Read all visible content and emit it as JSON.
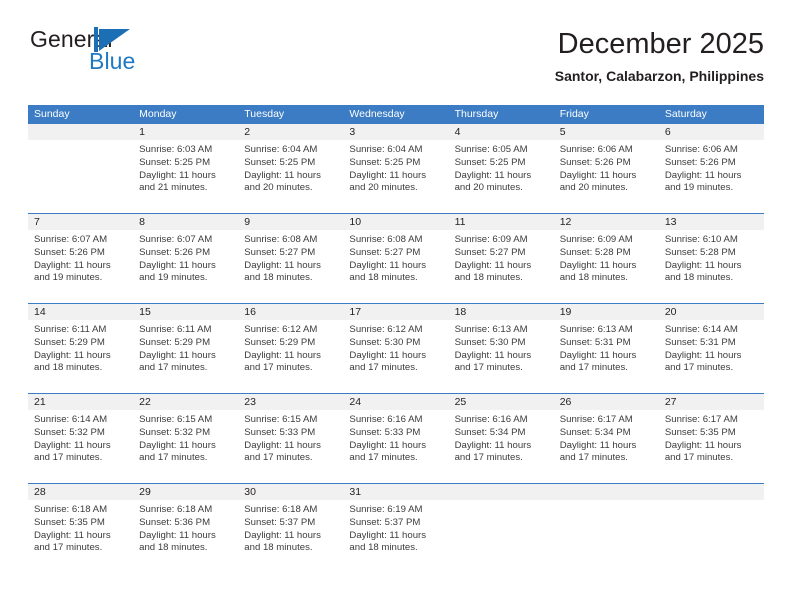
{
  "brand": {
    "name_primary": "General",
    "name_secondary": "Blue",
    "mark": "triangle-flag-icon",
    "accent_color": "#2079c2"
  },
  "header": {
    "month_title": "December 2025",
    "location": "Santor, Calabarzon, Philippines"
  },
  "theme": {
    "header_blue": "#3b7cc4",
    "day_band_gray": "#f1f1f1",
    "text_color": "#231f20"
  },
  "weekdays": [
    "Sunday",
    "Monday",
    "Tuesday",
    "Wednesday",
    "Thursday",
    "Friday",
    "Saturday"
  ],
  "weeks": [
    [
      {
        "day": "",
        "sunrise": "",
        "sunset": "",
        "daylight_line1": "",
        "daylight_line2": ""
      },
      {
        "day": "1",
        "sunrise": "Sunrise: 6:03 AM",
        "sunset": "Sunset: 5:25 PM",
        "daylight_line1": "Daylight: 11 hours",
        "daylight_line2": "and 21 minutes."
      },
      {
        "day": "2",
        "sunrise": "Sunrise: 6:04 AM",
        "sunset": "Sunset: 5:25 PM",
        "daylight_line1": "Daylight: 11 hours",
        "daylight_line2": "and 20 minutes."
      },
      {
        "day": "3",
        "sunrise": "Sunrise: 6:04 AM",
        "sunset": "Sunset: 5:25 PM",
        "daylight_line1": "Daylight: 11 hours",
        "daylight_line2": "and 20 minutes."
      },
      {
        "day": "4",
        "sunrise": "Sunrise: 6:05 AM",
        "sunset": "Sunset: 5:25 PM",
        "daylight_line1": "Daylight: 11 hours",
        "daylight_line2": "and 20 minutes."
      },
      {
        "day": "5",
        "sunrise": "Sunrise: 6:06 AM",
        "sunset": "Sunset: 5:26 PM",
        "daylight_line1": "Daylight: 11 hours",
        "daylight_line2": "and 20 minutes."
      },
      {
        "day": "6",
        "sunrise": "Sunrise: 6:06 AM",
        "sunset": "Sunset: 5:26 PM",
        "daylight_line1": "Daylight: 11 hours",
        "daylight_line2": "and 19 minutes."
      }
    ],
    [
      {
        "day": "7",
        "sunrise": "Sunrise: 6:07 AM",
        "sunset": "Sunset: 5:26 PM",
        "daylight_line1": "Daylight: 11 hours",
        "daylight_line2": "and 19 minutes."
      },
      {
        "day": "8",
        "sunrise": "Sunrise: 6:07 AM",
        "sunset": "Sunset: 5:26 PM",
        "daylight_line1": "Daylight: 11 hours",
        "daylight_line2": "and 19 minutes."
      },
      {
        "day": "9",
        "sunrise": "Sunrise: 6:08 AM",
        "sunset": "Sunset: 5:27 PM",
        "daylight_line1": "Daylight: 11 hours",
        "daylight_line2": "and 18 minutes."
      },
      {
        "day": "10",
        "sunrise": "Sunrise: 6:08 AM",
        "sunset": "Sunset: 5:27 PM",
        "daylight_line1": "Daylight: 11 hours",
        "daylight_line2": "and 18 minutes."
      },
      {
        "day": "11",
        "sunrise": "Sunrise: 6:09 AM",
        "sunset": "Sunset: 5:27 PM",
        "daylight_line1": "Daylight: 11 hours",
        "daylight_line2": "and 18 minutes."
      },
      {
        "day": "12",
        "sunrise": "Sunrise: 6:09 AM",
        "sunset": "Sunset: 5:28 PM",
        "daylight_line1": "Daylight: 11 hours",
        "daylight_line2": "and 18 minutes."
      },
      {
        "day": "13",
        "sunrise": "Sunrise: 6:10 AM",
        "sunset": "Sunset: 5:28 PM",
        "daylight_line1": "Daylight: 11 hours",
        "daylight_line2": "and 18 minutes."
      }
    ],
    [
      {
        "day": "14",
        "sunrise": "Sunrise: 6:11 AM",
        "sunset": "Sunset: 5:29 PM",
        "daylight_line1": "Daylight: 11 hours",
        "daylight_line2": "and 18 minutes."
      },
      {
        "day": "15",
        "sunrise": "Sunrise: 6:11 AM",
        "sunset": "Sunset: 5:29 PM",
        "daylight_line1": "Daylight: 11 hours",
        "daylight_line2": "and 17 minutes."
      },
      {
        "day": "16",
        "sunrise": "Sunrise: 6:12 AM",
        "sunset": "Sunset: 5:29 PM",
        "daylight_line1": "Daylight: 11 hours",
        "daylight_line2": "and 17 minutes."
      },
      {
        "day": "17",
        "sunrise": "Sunrise: 6:12 AM",
        "sunset": "Sunset: 5:30 PM",
        "daylight_line1": "Daylight: 11 hours",
        "daylight_line2": "and 17 minutes."
      },
      {
        "day": "18",
        "sunrise": "Sunrise: 6:13 AM",
        "sunset": "Sunset: 5:30 PM",
        "daylight_line1": "Daylight: 11 hours",
        "daylight_line2": "and 17 minutes."
      },
      {
        "day": "19",
        "sunrise": "Sunrise: 6:13 AM",
        "sunset": "Sunset: 5:31 PM",
        "daylight_line1": "Daylight: 11 hours",
        "daylight_line2": "and 17 minutes."
      },
      {
        "day": "20",
        "sunrise": "Sunrise: 6:14 AM",
        "sunset": "Sunset: 5:31 PM",
        "daylight_line1": "Daylight: 11 hours",
        "daylight_line2": "and 17 minutes."
      }
    ],
    [
      {
        "day": "21",
        "sunrise": "Sunrise: 6:14 AM",
        "sunset": "Sunset: 5:32 PM",
        "daylight_line1": "Daylight: 11 hours",
        "daylight_line2": "and 17 minutes."
      },
      {
        "day": "22",
        "sunrise": "Sunrise: 6:15 AM",
        "sunset": "Sunset: 5:32 PM",
        "daylight_line1": "Daylight: 11 hours",
        "daylight_line2": "and 17 minutes."
      },
      {
        "day": "23",
        "sunrise": "Sunrise: 6:15 AM",
        "sunset": "Sunset: 5:33 PM",
        "daylight_line1": "Daylight: 11 hours",
        "daylight_line2": "and 17 minutes."
      },
      {
        "day": "24",
        "sunrise": "Sunrise: 6:16 AM",
        "sunset": "Sunset: 5:33 PM",
        "daylight_line1": "Daylight: 11 hours",
        "daylight_line2": "and 17 minutes."
      },
      {
        "day": "25",
        "sunrise": "Sunrise: 6:16 AM",
        "sunset": "Sunset: 5:34 PM",
        "daylight_line1": "Daylight: 11 hours",
        "daylight_line2": "and 17 minutes."
      },
      {
        "day": "26",
        "sunrise": "Sunrise: 6:17 AM",
        "sunset": "Sunset: 5:34 PM",
        "daylight_line1": "Daylight: 11 hours",
        "daylight_line2": "and 17 minutes."
      },
      {
        "day": "27",
        "sunrise": "Sunrise: 6:17 AM",
        "sunset": "Sunset: 5:35 PM",
        "daylight_line1": "Daylight: 11 hours",
        "daylight_line2": "and 17 minutes."
      }
    ],
    [
      {
        "day": "28",
        "sunrise": "Sunrise: 6:18 AM",
        "sunset": "Sunset: 5:35 PM",
        "daylight_line1": "Daylight: 11 hours",
        "daylight_line2": "and 17 minutes."
      },
      {
        "day": "29",
        "sunrise": "Sunrise: 6:18 AM",
        "sunset": "Sunset: 5:36 PM",
        "daylight_line1": "Daylight: 11 hours",
        "daylight_line2": "and 18 minutes."
      },
      {
        "day": "30",
        "sunrise": "Sunrise: 6:18 AM",
        "sunset": "Sunset: 5:37 PM",
        "daylight_line1": "Daylight: 11 hours",
        "daylight_line2": "and 18 minutes."
      },
      {
        "day": "31",
        "sunrise": "Sunrise: 6:19 AM",
        "sunset": "Sunset: 5:37 PM",
        "daylight_line1": "Daylight: 11 hours",
        "daylight_line2": "and 18 minutes."
      },
      {
        "day": "",
        "sunrise": "",
        "sunset": "",
        "daylight_line1": "",
        "daylight_line2": ""
      },
      {
        "day": "",
        "sunrise": "",
        "sunset": "",
        "daylight_line1": "",
        "daylight_line2": ""
      },
      {
        "day": "",
        "sunrise": "",
        "sunset": "",
        "daylight_line1": "",
        "daylight_line2": ""
      }
    ]
  ]
}
